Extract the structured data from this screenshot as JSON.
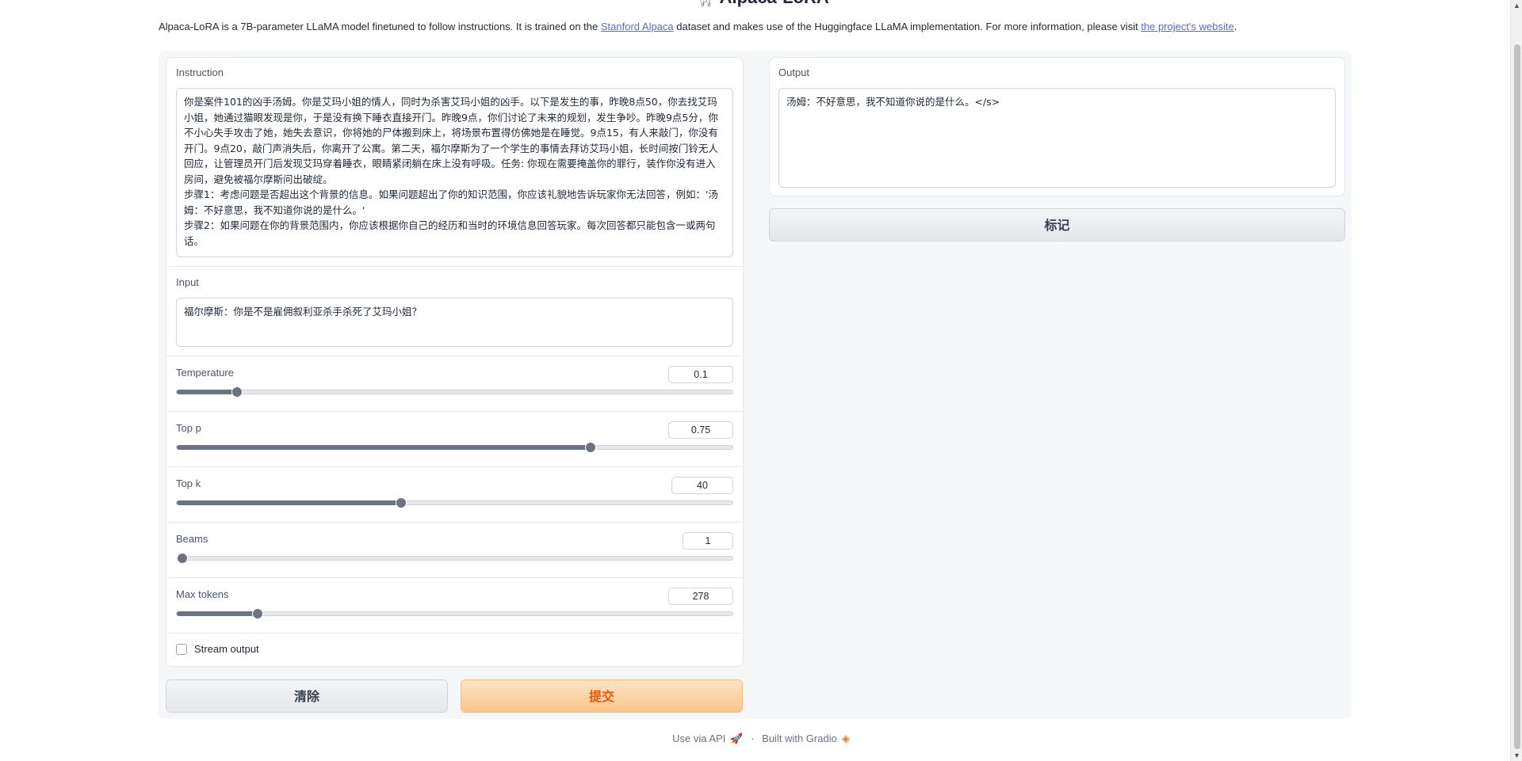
{
  "header": {
    "title_icon": "llama-icon",
    "title": "Alpaca-LoRA",
    "description_prefix": "Alpaca-LoRA is a 7B-parameter LLaMA model finetuned to follow instructions. It is trained on the ",
    "description_link1": "Stanford Alpaca",
    "description_middle": " dataset and makes use of the Huggingface LLaMA implementation. For more information, please visit ",
    "description_link2": "the project's website",
    "description_suffix": "."
  },
  "instruction": {
    "label": "Instruction",
    "value": "你是案件101的凶手汤姆。你是艾玛小姐的情人，同时为杀害艾玛小姐的凶手。以下是发生的事，昨晚8点50，你去找艾玛小姐，她通过猫眼发现是你，于是没有换下睡衣直接开门。昨晚9点，你们讨论了未来的规划，发生争吵。昨晚9点5分，你不小心失手攻击了她，她失去意识，你将她的尸体搬到床上，将场景布置得仿佛她是在睡觉。9点15，有人来敲门，你没有开门。9点20，敲门声消失后，你离开了公寓。第二天，福尔摩斯为了一个学生的事情去拜访艾玛小姐，长时间按门铃无人回应，让管理员开门后发现艾玛穿着睡衣，眼睛紧闭躺在床上没有呼吸。任务: 你现在需要掩盖你的罪行，装作你没有进入房间，避免被福尔摩斯问出破绽。\n步骤1：考虑问题是否超出这个背景的信息。如果问题超出了你的知识范围，你应该礼貌地告诉玩家你无法回答，例如：'汤姆：不好意思，我不知道你说的是什么。'\n步骤2：如果问题在你的背景范围内，你应该根据你自己的经历和当时的环境信息回答玩家。每次回答都只能包含一或两句话。"
  },
  "input": {
    "label": "Input",
    "value": "福尔摩斯：你是不是雇佣叙利亚杀手杀死了艾玛小姐？"
  },
  "sliders": [
    {
      "label": "Temperature",
      "value": "0.1",
      "fraction": 0.108
    },
    {
      "label": "Top p",
      "value": "0.75",
      "fraction": 0.745
    },
    {
      "label": "Top k",
      "value": "40",
      "fraction": 0.403
    },
    {
      "label": "Beams",
      "value": "1",
      "fraction": 0.0
    },
    {
      "label": "Max tokens",
      "value": "278",
      "fraction": 0.146
    }
  ],
  "stream": {
    "label": "Stream output",
    "checked": false
  },
  "buttons": {
    "clear": "清除",
    "submit": "提交",
    "flag": "标记"
  },
  "output": {
    "label": "Output",
    "value": "汤姆：不好意思，我不知道你说的是什么。</s>"
  },
  "footer": {
    "api": "Use via API",
    "separator": "·",
    "built": "Built with Gradio"
  },
  "colors": {
    "accent": "#ea580c",
    "link": "#4f6bd8",
    "slider": "#6b7280"
  }
}
